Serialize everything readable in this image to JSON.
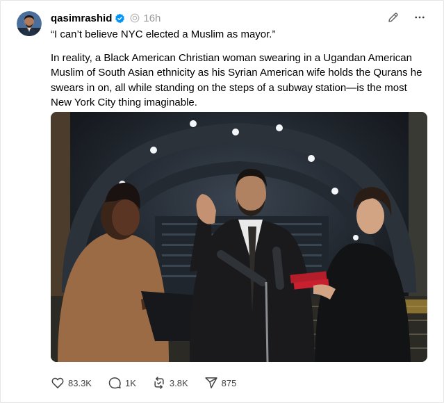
{
  "post": {
    "username": "qasimrashid",
    "time": "16h",
    "quote": "“I can’t believe NYC elected a Muslim as mayor.”",
    "body": "In reality, a Black American Christian woman swearing in a Ugandan American Muslim of South Asian ethnicity as his Syrian American wife holds the Qurans he swears in on, all while standing on the steps of a subway station—is the most New York City thing imaginable.",
    "verified_color": "#0095f6"
  },
  "actions": {
    "likes": "83.3K",
    "replies": "1K",
    "reposts": "3.8K",
    "shares": "875"
  },
  "icons": {
    "verified": "verified-badge-icon",
    "edit": "pencil-icon",
    "more": "ellipsis-icon",
    "like": "heart-icon",
    "reply": "comment-icon",
    "repost": "repost-icon",
    "share": "send-icon"
  }
}
